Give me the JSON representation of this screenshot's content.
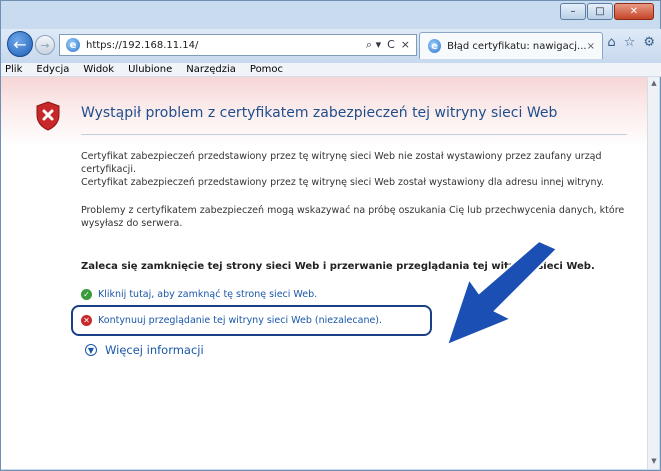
{
  "browser": {
    "url_prefix": "https://",
    "url_host": "192.168.11.14/",
    "tab_title": "Błąd certyfikatu: nawigacj...",
    "tab_close": "×",
    "addr_tools": [
      "⌕ ▾",
      "C",
      "×"
    ]
  },
  "menu": [
    "Plik",
    "Edycja",
    "Widok",
    "Ulubione",
    "Narzędzia",
    "Pomoc"
  ],
  "page": {
    "title": "Wystąpił problem z certyfikatem zabezpieczeń tej witryny sieci Web",
    "para1_line1": "Certyfikat zabezpieczeń przedstawiony przez tę witrynę sieci Web nie został wystawiony przez zaufany urząd certyfikacji.",
    "para1_line2": "Certyfikat zabezpieczeń przedstawiony przez tę witrynę sieci Web został wystawiony dla adresu innej witryny.",
    "para2": "Problemy z certyfikatem zabezpieczeń mogą wskazywać na próbę oszukania Cię lub przechwycenia danych, które wysyłasz do serwera.",
    "recommend": "Zaleca się zamknięcie tej strony sieci Web i przerwanie przeglądania tej witryny sieci Web.",
    "link_close": "Kliknij tutaj, aby zamknąć tę stronę sieci Web.",
    "link_continue": "Kontynuuj przeglądanie tej witryny sieci Web (niezalecane).",
    "more_info": "Więcej informacji"
  },
  "colors": {
    "title_blue": "#1f4e8c",
    "link_blue": "#1a57a8",
    "highlight_navy": "#1b3f86",
    "shield_red": "#c8282a"
  },
  "icons": {
    "back": "back-arrow-icon",
    "forward": "forward-arrow-icon",
    "site": "ie-logo-icon",
    "home": "home-icon",
    "favorites": "star-icon",
    "tools": "gear-icon",
    "error": "shield-error-icon",
    "ok": "shield-ok-icon",
    "bad": "shield-bad-icon",
    "more": "chevron-down-icon",
    "annotation": "pointer-arrow-icon"
  }
}
